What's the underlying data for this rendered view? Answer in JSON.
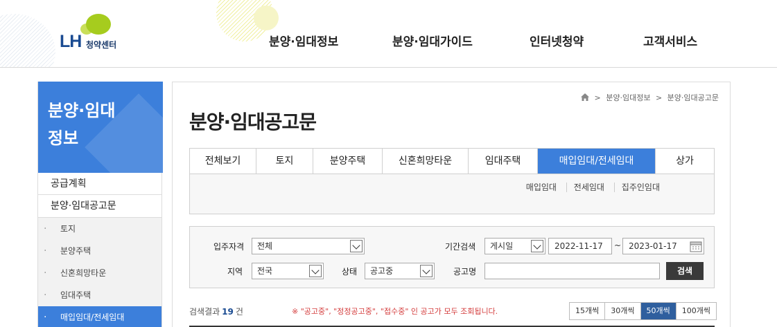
{
  "header": {
    "logo_text": "LH",
    "logo_sub": "청약센터",
    "nav": [
      "분양·임대정보",
      "분양·임대가이드",
      "인터넷청약",
      "고객서비스"
    ]
  },
  "sidebar": {
    "title_line1": "분양·임대",
    "title_line2": "정보",
    "items": [
      "공급계획",
      "분양·임대공고문"
    ],
    "sub_items": [
      "토지",
      "분양주택",
      "신혼희망타운",
      "임대주택",
      "매입임대/전세임대"
    ]
  },
  "breadcrumb": [
    "분양·임대정보",
    "분양·임대공고문"
  ],
  "page_title": "분양·임대공고문",
  "tabs": [
    "전체보기",
    "토지",
    "분양주택",
    "신혼희망타운",
    "임대주택",
    "매입임대/전세임대",
    "상가"
  ],
  "subtabs": [
    "매입임대",
    "전세임대",
    "집주인임대"
  ],
  "search": {
    "qualification_label": "입주자격",
    "qualification_value": "전체",
    "period_label": "기간검색",
    "period_type": "게시일",
    "date_from": "2022-11-17",
    "date_to": "2023-01-17",
    "tilde": "~",
    "region_label": "지역",
    "region_value": "전국",
    "status_label": "상태",
    "status_value": "공고중",
    "name_label": "공고명",
    "name_value": "",
    "button": "검색"
  },
  "results": {
    "prefix": "검색결과",
    "count": "19",
    "suffix": "건",
    "notice": "※ \"공고중\", \"정정공고중\", \"접수중\" 인 공고가 모두 조회됩니다.",
    "page_sizes": [
      "15개씩",
      "30개씩",
      "50개씩",
      "100개씩"
    ]
  },
  "colors": {
    "accent": "#3c7fdb",
    "brand": "#1a4b92",
    "logo_green": "#a6cc1e",
    "notice_red": "#d43c3c"
  }
}
